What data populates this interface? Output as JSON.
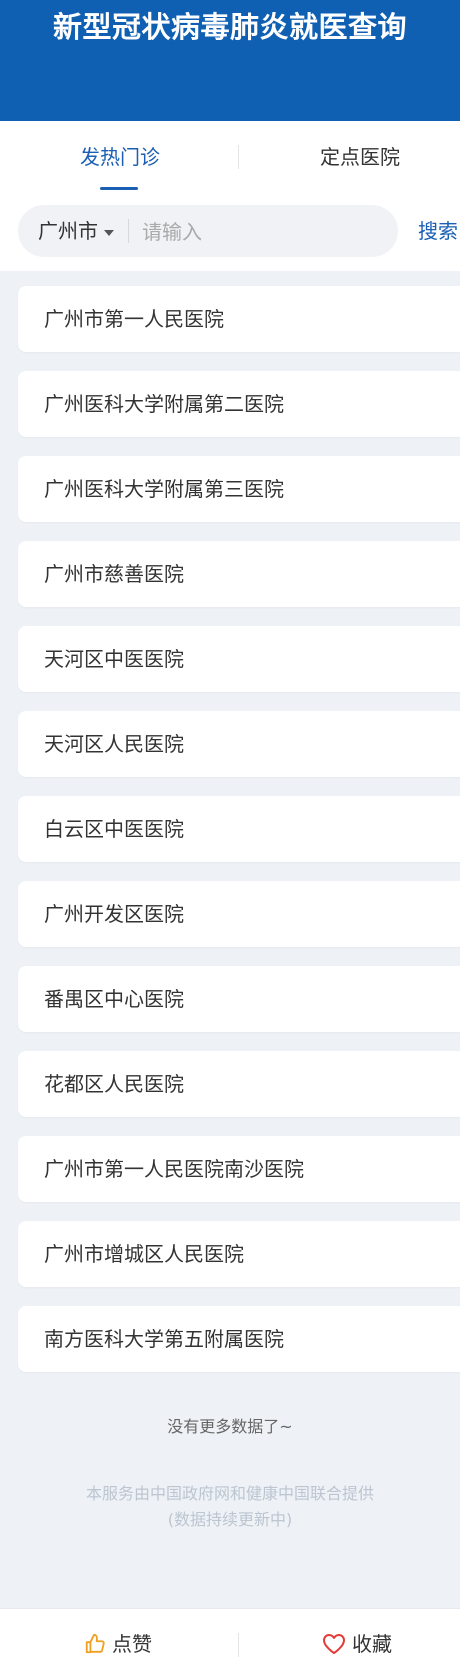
{
  "header": {
    "title": "新型冠状病毒肺炎就医查询"
  },
  "tabs": [
    {
      "label": "发热门诊",
      "active": true
    },
    {
      "label": "定点医院",
      "active": false
    }
  ],
  "search": {
    "city": "广州市",
    "placeholder": "请输入",
    "button_label": "搜索"
  },
  "hospitals": [
    "广州市第一人民医院",
    "广州医科大学附属第二医院",
    "广州医科大学附属第三医院",
    "广州市慈善医院",
    "天河区中医医院",
    "天河区人民医院",
    "白云区中医医院",
    "广州开发区医院",
    "番禺区中心医院",
    "花都区人民医院",
    "广州市第一人民医院南沙医院",
    "广州市增城区人民医院",
    "南方医科大学第五附属医院"
  ],
  "list_end_text": "没有更多数据了~",
  "footer": {
    "line1": "本服务由中国政府网和健康中国联合提供",
    "line2": "(数据持续更新中)"
  },
  "bottom_bar": {
    "like_label": "点赞",
    "favorite_label": "收藏"
  },
  "colors": {
    "header_bg": "#0f5fb3",
    "accent": "#1a5fb4",
    "like_icon": "#f0a020",
    "favorite_icon": "#e53935"
  },
  "icons": {
    "like": "thumbs-up-icon",
    "favorite": "heart-icon",
    "city_dropdown": "caret-down-icon"
  }
}
